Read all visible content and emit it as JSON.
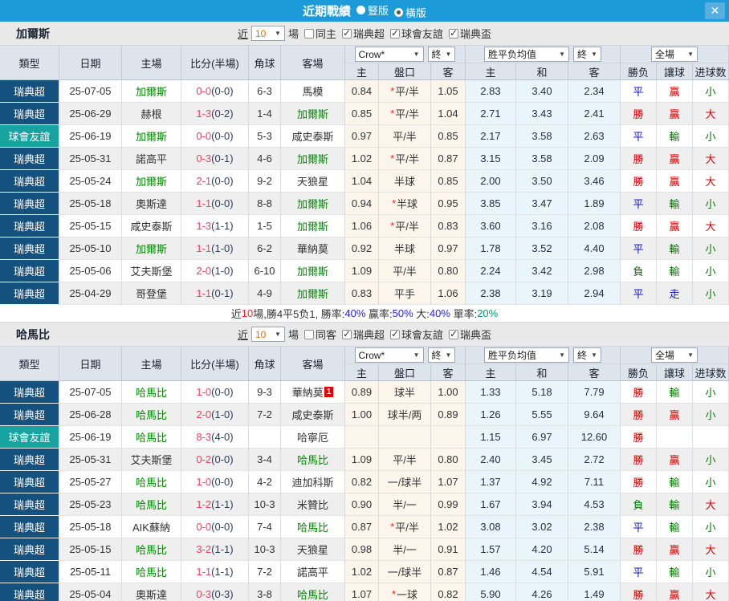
{
  "titlebar": {
    "title": "近期戰績",
    "layout_options": [
      {
        "label": "豎版",
        "selected": false
      },
      {
        "label": "橫版",
        "selected": true
      }
    ],
    "close_label": "✕"
  },
  "controls": {
    "near_label": "近",
    "games_count": "10",
    "games_label": "場"
  },
  "table_header": {
    "col_type": "類型",
    "col_date": "日期",
    "col_home": "主場",
    "col_score": "比分(半場)",
    "col_corner": "角球",
    "col_away": "客場",
    "odds_source_dropdown": "Crow*",
    "odds_final_dropdown": "終",
    "mean_dropdown": "胜平负均值",
    "mean_final_dropdown": "終",
    "fulltime_dropdown": "全場",
    "sub_home": "主",
    "sub_handicap": "盤口",
    "sub_away": "客",
    "sub_mean_home": "主",
    "sub_mean_draw": "和",
    "sub_mean_away": "客",
    "sub_result": "勝负",
    "sub_handicap_result": "讓球",
    "sub_goals": "进球数"
  },
  "colors": {
    "titlebar_blue": "#1d9bd8",
    "league_navy": "#14517f",
    "friendly_teal": "#17a39f",
    "focus_team_green": "#008800",
    "score_red": "#f43f5e",
    "win_red": "#d40000",
    "draw_blue": "#1414cc",
    "lose_green": "#007700",
    "odds_col_bg": "#fcf5ec",
    "mean_col_bg": "#eaf4fb"
  },
  "sections": [
    {
      "team": "加爾斯",
      "same_filter": {
        "label": "同主",
        "checked": false
      },
      "leagues": [
        {
          "label": "瑞典超",
          "checked": true
        },
        {
          "label": "球會友誼",
          "checked": true
        },
        {
          "label": "瑞典盃",
          "checked": true
        }
      ],
      "rows": [
        {
          "type": "瑞典超",
          "league_color": "navy",
          "date": "25-07-05",
          "home": "加爾斯",
          "home_focus": true,
          "score_ft": "0-0",
          "score_ht": "(0-0)",
          "corners": "6-3",
          "away": "馬模",
          "away_focus": false,
          "away_badge": "",
          "odds_home": "0.84",
          "handicap_star": true,
          "handicap": "平/半",
          "odds_away": "1.05",
          "mean_home": "2.83",
          "mean_draw": "3.40",
          "mean_away": "2.34",
          "result": "平",
          "result_color": "blue",
          "handicap_result": "贏",
          "handicap_result_color": "red",
          "goals": "小",
          "goals_color": "green"
        },
        {
          "type": "瑞典超",
          "league_color": "navy",
          "date": "25-06-29",
          "home": "赫根",
          "home_focus": false,
          "score_ft": "1-3",
          "score_ht": "(0-2)",
          "corners": "1-4",
          "away": "加爾斯",
          "away_focus": true,
          "away_badge": "",
          "odds_home": "0.85",
          "handicap_star": true,
          "handicap": "平/半",
          "odds_away": "1.04",
          "mean_home": "2.71",
          "mean_draw": "3.43",
          "mean_away": "2.41",
          "result": "勝",
          "result_color": "red",
          "handicap_result": "贏",
          "handicap_result_color": "red",
          "goals": "大",
          "goals_color": "red"
        },
        {
          "type": "球會友誼",
          "league_color": "teal",
          "date": "25-06-19",
          "home": "加爾斯",
          "home_focus": true,
          "score_ft": "0-0",
          "score_ht": "(0-0)",
          "corners": "5-3",
          "away": "咸史泰斯",
          "away_focus": false,
          "away_badge": "",
          "odds_home": "0.97",
          "handicap_star": false,
          "handicap": "平/半",
          "odds_away": "0.85",
          "mean_home": "2.17",
          "mean_draw": "3.58",
          "mean_away": "2.63",
          "result": "平",
          "result_color": "blue",
          "handicap_result": "輸",
          "handicap_result_color": "green",
          "goals": "小",
          "goals_color": "green"
        },
        {
          "type": "瑞典超",
          "league_color": "navy",
          "date": "25-05-31",
          "home": "諾高平",
          "home_focus": false,
          "score_ft": "0-3",
          "score_ht": "(0-1)",
          "corners": "4-6",
          "away": "加爾斯",
          "away_focus": true,
          "away_badge": "",
          "odds_home": "1.02",
          "handicap_star": true,
          "handicap": "平/半",
          "odds_away": "0.87",
          "mean_home": "3.15",
          "mean_draw": "3.58",
          "mean_away": "2.09",
          "result": "勝",
          "result_color": "red",
          "handicap_result": "贏",
          "handicap_result_color": "red",
          "goals": "大",
          "goals_color": "red"
        },
        {
          "type": "瑞典超",
          "league_color": "navy",
          "date": "25-05-24",
          "home": "加爾斯",
          "home_focus": true,
          "score_ft": "2-1",
          "score_ht": "(0-0)",
          "corners": "9-2",
          "away": "天狼星",
          "away_focus": false,
          "away_badge": "",
          "odds_home": "1.04",
          "handicap_star": false,
          "handicap": "半球",
          "odds_away": "0.85",
          "mean_home": "2.00",
          "mean_draw": "3.50",
          "mean_away": "3.46",
          "result": "勝",
          "result_color": "red",
          "handicap_result": "贏",
          "handicap_result_color": "red",
          "goals": "大",
          "goals_color": "red"
        },
        {
          "type": "瑞典超",
          "league_color": "navy",
          "date": "25-05-18",
          "home": "奧斯達",
          "home_focus": false,
          "score_ft": "1-1",
          "score_ht": "(0-0)",
          "corners": "8-8",
          "away": "加爾斯",
          "away_focus": true,
          "away_badge": "",
          "odds_home": "0.94",
          "handicap_star": true,
          "handicap": "半球",
          "odds_away": "0.95",
          "mean_home": "3.85",
          "mean_draw": "3.47",
          "mean_away": "1.89",
          "result": "平",
          "result_color": "blue",
          "handicap_result": "輸",
          "handicap_result_color": "green",
          "goals": "小",
          "goals_color": "green"
        },
        {
          "type": "瑞典超",
          "league_color": "navy",
          "date": "25-05-15",
          "home": "咸史泰斯",
          "home_focus": false,
          "score_ft": "1-3",
          "score_ht": "(1-1)",
          "corners": "1-5",
          "away": "加爾斯",
          "away_focus": true,
          "away_badge": "",
          "odds_home": "1.06",
          "handicap_star": true,
          "handicap": "平/半",
          "odds_away": "0.83",
          "mean_home": "3.60",
          "mean_draw": "3.16",
          "mean_away": "2.08",
          "result": "勝",
          "result_color": "red",
          "handicap_result": "贏",
          "handicap_result_color": "red",
          "goals": "大",
          "goals_color": "red"
        },
        {
          "type": "瑞典超",
          "league_color": "navy",
          "date": "25-05-10",
          "home": "加爾斯",
          "home_focus": true,
          "score_ft": "1-1",
          "score_ht": "(1-0)",
          "corners": "6-2",
          "away": "華納莫",
          "away_focus": false,
          "away_badge": "",
          "odds_home": "0.92",
          "handicap_star": false,
          "handicap": "半球",
          "odds_away": "0.97",
          "mean_home": "1.78",
          "mean_draw": "3.52",
          "mean_away": "4.40",
          "result": "平",
          "result_color": "blue",
          "handicap_result": "輸",
          "handicap_result_color": "green",
          "goals": "小",
          "goals_color": "green"
        },
        {
          "type": "瑞典超",
          "league_color": "navy",
          "date": "25-05-06",
          "home": "艾夫斯堡",
          "home_focus": false,
          "score_ft": "2-0",
          "score_ht": "(1-0)",
          "corners": "6-10",
          "away": "加爾斯",
          "away_focus": true,
          "away_badge": "",
          "odds_home": "1.09",
          "handicap_star": false,
          "handicap": "平/半",
          "odds_away": "0.80",
          "mean_home": "2.24",
          "mean_draw": "3.42",
          "mean_away": "2.98",
          "result": "負",
          "result_color": "green",
          "handicap_result": "輸",
          "handicap_result_color": "green",
          "goals": "小",
          "goals_color": "green"
        },
        {
          "type": "瑞典超",
          "league_color": "navy",
          "date": "25-04-29",
          "home": "哥登堡",
          "home_focus": false,
          "score_ft": "1-1",
          "score_ht": "(0-1)",
          "corners": "4-9",
          "away": "加爾斯",
          "away_focus": true,
          "away_badge": "",
          "odds_home": "0.83",
          "handicap_star": false,
          "handicap": "平手",
          "odds_away": "1.06",
          "mean_home": "2.38",
          "mean_draw": "3.19",
          "mean_away": "2.94",
          "result": "平",
          "result_color": "blue",
          "handicap_result": "走",
          "handicap_result_color": "blue",
          "goals": "小",
          "goals_color": "green"
        }
      ],
      "summary": [
        {
          "text": "近",
          "color": "dark"
        },
        {
          "text": "10",
          "color": "red"
        },
        {
          "text": "場,勝4平5负1, 勝率:",
          "color": "dark"
        },
        {
          "text": "40%",
          "color": "blue"
        },
        {
          "text": " 贏率:",
          "color": "dark"
        },
        {
          "text": "50%",
          "color": "blue"
        },
        {
          "text": " 大:",
          "color": "dark"
        },
        {
          "text": "40%",
          "color": "blue"
        },
        {
          "text": " 單率:",
          "color": "dark"
        },
        {
          "text": "20%",
          "color": "green"
        }
      ]
    },
    {
      "team": "哈馬比",
      "same_filter": {
        "label": "同客",
        "checked": false
      },
      "leagues": [
        {
          "label": "瑞典超",
          "checked": true
        },
        {
          "label": "球會友誼",
          "checked": true
        },
        {
          "label": "瑞典盃",
          "checked": true
        }
      ],
      "rows": [
        {
          "type": "瑞典超",
          "league_color": "navy",
          "date": "25-07-05",
          "home": "哈馬比",
          "home_focus": true,
          "score_ft": "1-0",
          "score_ht": "(0-0)",
          "corners": "9-3",
          "away": "華納莫",
          "away_focus": false,
          "away_badge": "1",
          "odds_home": "0.89",
          "handicap_star": false,
          "handicap": "球半",
          "odds_away": "1.00",
          "mean_home": "1.33",
          "mean_draw": "5.18",
          "mean_away": "7.79",
          "result": "勝",
          "result_color": "red",
          "handicap_result": "輸",
          "handicap_result_color": "green",
          "goals": "小",
          "goals_color": "green"
        },
        {
          "type": "瑞典超",
          "league_color": "navy",
          "date": "25-06-28",
          "home": "哈馬比",
          "home_focus": true,
          "score_ft": "2-0",
          "score_ht": "(1-0)",
          "corners": "7-2",
          "away": "咸史泰斯",
          "away_focus": false,
          "away_badge": "",
          "odds_home": "1.00",
          "handicap_star": false,
          "handicap": "球半/两",
          "odds_away": "0.89",
          "mean_home": "1.26",
          "mean_draw": "5.55",
          "mean_away": "9.64",
          "result": "勝",
          "result_color": "red",
          "handicap_result": "贏",
          "handicap_result_color": "red",
          "goals": "小",
          "goals_color": "green"
        },
        {
          "type": "球會友誼",
          "league_color": "teal",
          "date": "25-06-19",
          "home": "哈馬比",
          "home_focus": true,
          "score_ft": "8-3",
          "score_ht": "(4-0)",
          "corners": "",
          "away": "哈寧厄",
          "away_focus": false,
          "away_badge": "",
          "odds_home": "",
          "handicap_star": false,
          "handicap": "",
          "odds_away": "",
          "mean_home": "1.15",
          "mean_draw": "6.97",
          "mean_away": "12.60",
          "result": "勝",
          "result_color": "red",
          "handicap_result": "",
          "handicap_result_color": "dark",
          "goals": "",
          "goals_color": "dark"
        },
        {
          "type": "瑞典超",
          "league_color": "navy",
          "date": "25-05-31",
          "home": "艾夫斯堡",
          "home_focus": false,
          "score_ft": "0-2",
          "score_ht": "(0-0)",
          "corners": "3-4",
          "away": "哈馬比",
          "away_focus": true,
          "away_badge": "",
          "odds_home": "1.09",
          "handicap_star": false,
          "handicap": "平/半",
          "odds_away": "0.80",
          "mean_home": "2.40",
          "mean_draw": "3.45",
          "mean_away": "2.72",
          "result": "勝",
          "result_color": "red",
          "handicap_result": "贏",
          "handicap_result_color": "red",
          "goals": "小",
          "goals_color": "green"
        },
        {
          "type": "瑞典超",
          "league_color": "navy",
          "date": "25-05-27",
          "home": "哈馬比",
          "home_focus": true,
          "score_ft": "1-0",
          "score_ht": "(0-0)",
          "corners": "4-2",
          "away": "迪加科斯",
          "away_focus": false,
          "away_badge": "",
          "odds_home": "0.82",
          "handicap_star": false,
          "handicap": "一/球半",
          "odds_away": "1.07",
          "mean_home": "1.37",
          "mean_draw": "4.92",
          "mean_away": "7.11",
          "result": "勝",
          "result_color": "red",
          "handicap_result": "輸",
          "handicap_result_color": "green",
          "goals": "小",
          "goals_color": "green"
        },
        {
          "type": "瑞典超",
          "league_color": "navy",
          "date": "25-05-23",
          "home": "哈馬比",
          "home_focus": true,
          "score_ft": "1-2",
          "score_ht": "(1-1)",
          "corners": "10-3",
          "away": "米贊比",
          "away_focus": false,
          "away_badge": "",
          "odds_home": "0.90",
          "handicap_star": false,
          "handicap": "半/一",
          "odds_away": "0.99",
          "mean_home": "1.67",
          "mean_draw": "3.94",
          "mean_away": "4.53",
          "result": "負",
          "result_color": "green",
          "handicap_result": "輸",
          "handicap_result_color": "green",
          "goals": "大",
          "goals_color": "red"
        },
        {
          "type": "瑞典超",
          "league_color": "navy",
          "date": "25-05-18",
          "home": "AIK蘇納",
          "home_focus": false,
          "score_ft": "0-0",
          "score_ht": "(0-0)",
          "corners": "7-4",
          "away": "哈馬比",
          "away_focus": true,
          "away_badge": "",
          "odds_home": "0.87",
          "handicap_star": true,
          "handicap": "平/半",
          "odds_away": "1.02",
          "mean_home": "3.08",
          "mean_draw": "3.02",
          "mean_away": "2.38",
          "result": "平",
          "result_color": "blue",
          "handicap_result": "輸",
          "handicap_result_color": "green",
          "goals": "小",
          "goals_color": "green"
        },
        {
          "type": "瑞典超",
          "league_color": "navy",
          "date": "25-05-15",
          "home": "哈馬比",
          "home_focus": true,
          "score_ft": "3-2",
          "score_ht": "(1-1)",
          "corners": "10-3",
          "away": "天狼星",
          "away_focus": false,
          "away_badge": "",
          "odds_home": "0.98",
          "handicap_star": false,
          "handicap": "半/一",
          "odds_away": "0.91",
          "mean_home": "1.57",
          "mean_draw": "4.20",
          "mean_away": "5.14",
          "result": "勝",
          "result_color": "red",
          "handicap_result": "贏",
          "handicap_result_color": "red",
          "goals": "大",
          "goals_color": "red"
        },
        {
          "type": "瑞典超",
          "league_color": "navy",
          "date": "25-05-11",
          "home": "哈馬比",
          "home_focus": true,
          "score_ft": "1-1",
          "score_ht": "(1-1)",
          "corners": "7-2",
          "away": "諾高平",
          "away_focus": false,
          "away_badge": "",
          "odds_home": "1.02",
          "handicap_star": false,
          "handicap": "一/球半",
          "odds_away": "0.87",
          "mean_home": "1.46",
          "mean_draw": "4.54",
          "mean_away": "5.91",
          "result": "平",
          "result_color": "blue",
          "handicap_result": "輸",
          "handicap_result_color": "green",
          "goals": "小",
          "goals_color": "green"
        },
        {
          "type": "瑞典超",
          "league_color": "navy",
          "date": "25-05-04",
          "home": "奧斯達",
          "home_focus": false,
          "score_ft": "0-3",
          "score_ht": "(0-3)",
          "corners": "3-8",
          "away": "哈馬比",
          "away_focus": true,
          "away_badge": "",
          "odds_home": "1.07",
          "handicap_star": true,
          "handicap": "一球",
          "odds_away": "0.82",
          "mean_home": "5.90",
          "mean_draw": "4.26",
          "mean_away": "1.49",
          "result": "勝",
          "result_color": "red",
          "handicap_result": "贏",
          "handicap_result_color": "red",
          "goals": "大",
          "goals_color": "red"
        }
      ],
      "summary": null
    }
  ]
}
